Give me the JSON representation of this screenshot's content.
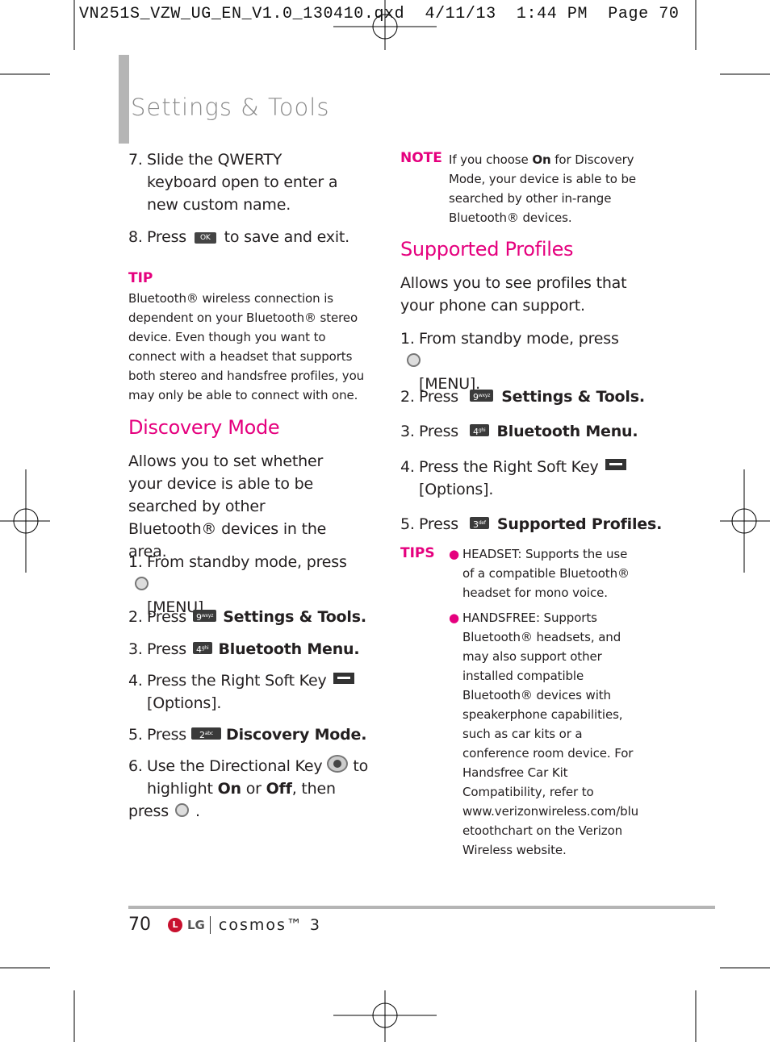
{
  "print_header": "VN251S_VZW_UG_EN_V1.0_130410.qxd  4/11/13  1:44 PM  Page 70",
  "title": "Settings & Tools",
  "left": {
    "step7": {
      "num": "7.",
      "text": "Slide the QWERTY keyboard open to enter a new custom name."
    },
    "step8": {
      "num": "8.",
      "pre": "Press",
      "key": "OK",
      "post": "to save and exit."
    },
    "tip": {
      "label": "TIP",
      "text": "Bluetooth® wireless connection is dependent on your Bluetooth® stereo device. Even though you want to connect with a headset that supports both stereo and handsfree profiles, you may only be able to connect with one."
    },
    "heading": "Discovery Mode",
    "description": "Allows you to set whether your device is able to be searched by other Bluetooth® devices in the area.",
    "steps": [
      {
        "num": "1.",
        "pre": "From standby mode, press",
        "post": "[MENU]."
      },
      {
        "num": "2.",
        "pre": "Press",
        "key": "9",
        "key_sub": "wxyz",
        "bold": "Settings & Tools."
      },
      {
        "num": "3.",
        "pre": "Press",
        "key": "4",
        "key_sub": "ghi",
        "bold": "Bluetooth Menu."
      },
      {
        "num": "4.",
        "pre": "Press the Right Soft Key",
        "post": "[Options]."
      },
      {
        "num": "5.",
        "pre": "Press",
        "key": "2",
        "key_sub": "abc",
        "bold": "Discovery Mode."
      },
      {
        "num": "6.",
        "pre": "Use the Directional Key",
        "mid": "to",
        "line2a": "highlight",
        "on": "On",
        "or": "or",
        "off": "Off",
        "line2b": ", then press",
        "end": "."
      }
    ]
  },
  "right": {
    "note": {
      "label": "NOTE",
      "pre": "If you choose",
      "bold": "On",
      "post": "for Discovery Mode, your device is able to be searched by other in-range Bluetooth® devices."
    },
    "heading": "Supported Profiles",
    "description": "Allows you to see profiles that your phone can support.",
    "steps": [
      {
        "num": "1.",
        "pre": "From standby mode, press",
        "post": "[MENU]."
      },
      {
        "num": "2.",
        "pre": "Press",
        "key": "9",
        "key_sub": "wxyz",
        "bold": "Settings & Tools."
      },
      {
        "num": "3.",
        "pre": "Press",
        "key": "4",
        "key_sub": "ghi",
        "bold": "Bluetooth Menu."
      },
      {
        "num": "4.",
        "pre": "Press the Right Soft Key",
        "post": "[Options]."
      },
      {
        "num": "5.",
        "pre": "Press",
        "key": "3",
        "key_sub": "def",
        "bold": "Supported Profiles."
      }
    ],
    "tips": {
      "label": "TIPS",
      "items": [
        "HEADSET: Supports the use of a compatible Bluetooth® headset for mono voice.",
        "HANDSFREE: Supports Bluetooth® headsets, and may also support other installed compatible Bluetooth® devices with speakerphone capabilities, such as car kits or a conference room device. For Handsfree Car Kit Compatibility, refer to www.verizonwireless.com/bluetoothchart on the Verizon Wireless website."
      ]
    }
  },
  "footer": {
    "page": "70",
    "brand": "LG",
    "product": "cosmos™ 3"
  },
  "colors": {
    "accent": "#e5007e",
    "bar": "#b5b5b5"
  }
}
